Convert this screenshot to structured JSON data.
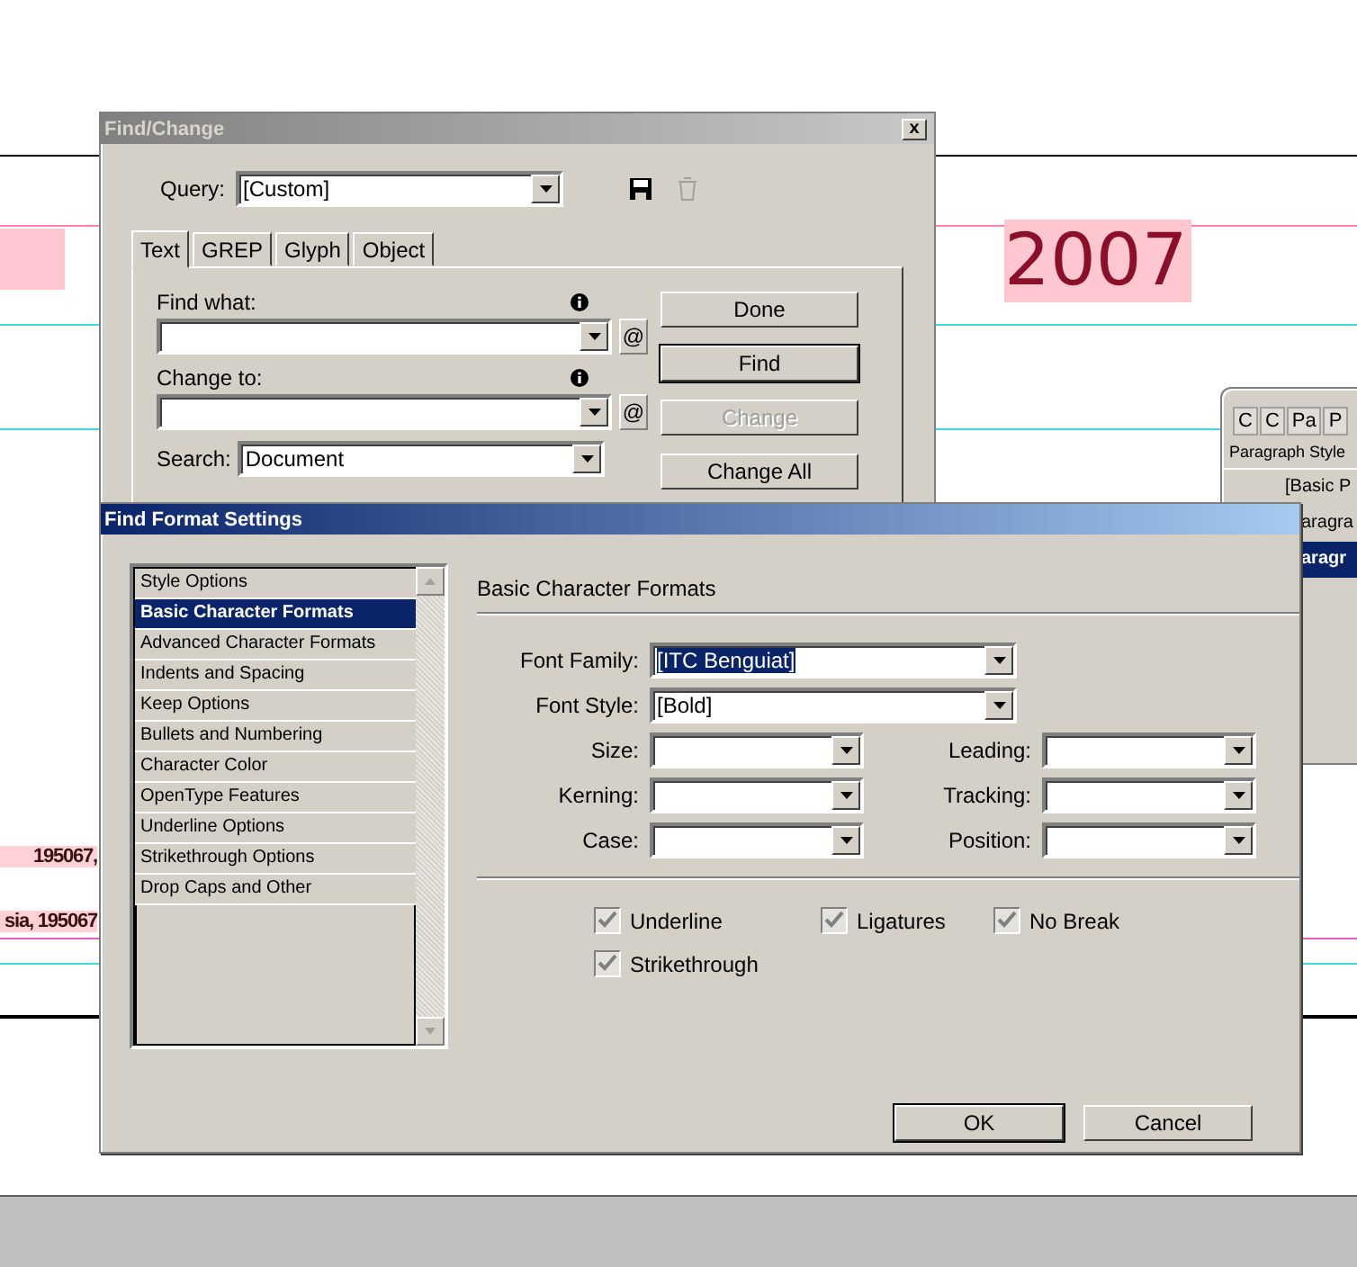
{
  "document": {
    "heading_fragment": "2007",
    "address_lines": [
      "195067,",
      "sia, 195067"
    ]
  },
  "find_change": {
    "title": "Find/Change",
    "close": "x",
    "query_label": "Query:",
    "query_value": "[Custom]",
    "tabs": [
      {
        "label": "Text",
        "selected": true
      },
      {
        "label": "GREP",
        "selected": false
      },
      {
        "label": "Glyph",
        "selected": false
      },
      {
        "label": "Object",
        "selected": false
      }
    ],
    "find_label": "Find what:",
    "change_label": "Change to:",
    "special_button": "@",
    "search_label": "Search:",
    "search_value": "Document",
    "buttons": [
      {
        "label": "Done",
        "default": false,
        "disabled": false
      },
      {
        "label": "Find",
        "default": true,
        "disabled": false
      },
      {
        "label": "Change",
        "default": false,
        "disabled": true
      },
      {
        "label": "Change All",
        "default": false,
        "disabled": false
      }
    ]
  },
  "styles_panel": {
    "tabs": [
      "C",
      "C",
      "Pa",
      "P"
    ],
    "header": "Paragraph Style",
    "items": [
      {
        "label": "[Basic P",
        "selected": false
      },
      {
        "label": "aragra",
        "selected": false
      },
      {
        "label": "aragr",
        "selected": true
      }
    ]
  },
  "find_format": {
    "title": "Find Format Settings",
    "categories": [
      {
        "label": "Style Options",
        "selected": false
      },
      {
        "label": "Basic Character Formats",
        "selected": true
      },
      {
        "label": "Advanced Character Formats",
        "selected": false
      },
      {
        "label": "Indents and Spacing",
        "selected": false
      },
      {
        "label": "Keep Options",
        "selected": false
      },
      {
        "label": "Bullets and Numbering",
        "selected": false
      },
      {
        "label": "Character Color",
        "selected": false
      },
      {
        "label": "OpenType Features",
        "selected": false
      },
      {
        "label": "Underline Options",
        "selected": false
      },
      {
        "label": "Strikethrough Options",
        "selected": false
      },
      {
        "label": "Drop Caps and Other",
        "selected": false
      }
    ],
    "section_title": "Basic Character Formats",
    "wide_fields": [
      {
        "label": "Font Family:",
        "value": "[ITC Benguiat]",
        "highlighted": true
      },
      {
        "label": "Font Style:",
        "value": "[Bold]",
        "highlighted": false
      }
    ],
    "narrow_fields": [
      {
        "label": "Size:"
      },
      {
        "label": "Leading:"
      },
      {
        "label": "Kerning:"
      },
      {
        "label": "Tracking:"
      },
      {
        "label": "Case:"
      },
      {
        "label": "Position:"
      }
    ],
    "checkboxes": [
      {
        "label": "Underline",
        "checked": true
      },
      {
        "label": "Ligatures",
        "checked": true
      },
      {
        "label": "No Break",
        "checked": true
      },
      {
        "label": "Strikethrough",
        "checked": true
      }
    ],
    "buttons": [
      "OK",
      "Cancel"
    ]
  }
}
